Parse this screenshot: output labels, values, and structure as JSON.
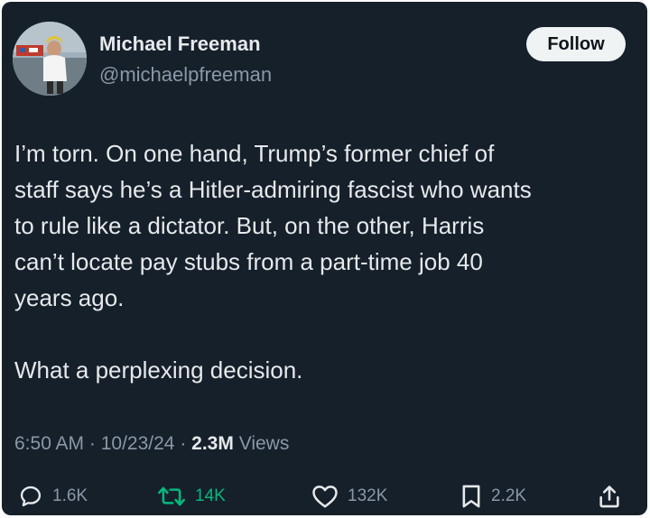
{
  "tweet": {
    "author": {
      "name": "Michael Freeman",
      "handle": "@michaelpfreeman"
    },
    "follow_label": "Follow",
    "text_lines": [
      "I’m torn.  On one hand, Trump’s former chief of",
      "staff says he’s a Hitler-admiring fascist who wants",
      "to rule like a dictator.  But, on the other, Harris",
      "can’t locate pay stubs from a part-time job 40",
      "years ago."
    ],
    "text_closing": "What a perplexing decision.",
    "time": "6:50 AM",
    "date": "10/23/24",
    "separator": " · ",
    "views_count": "2.3M",
    "views_label": "Views",
    "actions": {
      "replies": "1.6K",
      "retweets": "14K",
      "likes": "132K",
      "bookmarks": "2.2K"
    }
  },
  "colors": {
    "background": "#15202b",
    "text": "#e7e9ea",
    "secondary_text": "#8b98a5",
    "retweet": "#00ba7c",
    "follow_button_bg": "#eff3f4"
  },
  "icons": [
    "reply-icon",
    "retweet-icon",
    "like-icon",
    "bookmark-icon",
    "share-icon"
  ]
}
